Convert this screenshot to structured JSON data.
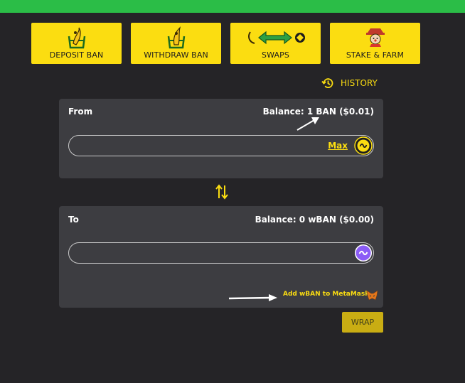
{
  "nav": {
    "deposit_label": "DEPOSIT BAN",
    "withdraw_label": "WITHDRAW BAN",
    "swaps_label": "SWAPS",
    "stake_label": "STAKE & FARM"
  },
  "history_label": "HISTORY",
  "from": {
    "title": "From",
    "balance": "Balance: 1 BAN ($0.01)",
    "max_label": "Max",
    "amount": ""
  },
  "to": {
    "title": "To",
    "balance": "Balance: 0 wBAN ($0.00)",
    "amount": ""
  },
  "metamask_label": "Add wBAN to MetaMask",
  "wrap_label": "WRAP",
  "colors": {
    "accent": "#fbdd11",
    "topbar": "#2bbd47",
    "background": "#252427",
    "card": "#3d3d41",
    "wban_purple": "#8b5cf6"
  },
  "icons": [
    "banana-deposit-icon",
    "banana-withdraw-icon",
    "swap-icon",
    "scarecrow-icon",
    "history-icon",
    "ban-coin-icon",
    "wban-coin-icon",
    "swap-arrows-icon",
    "metamask-fox-icon"
  ]
}
